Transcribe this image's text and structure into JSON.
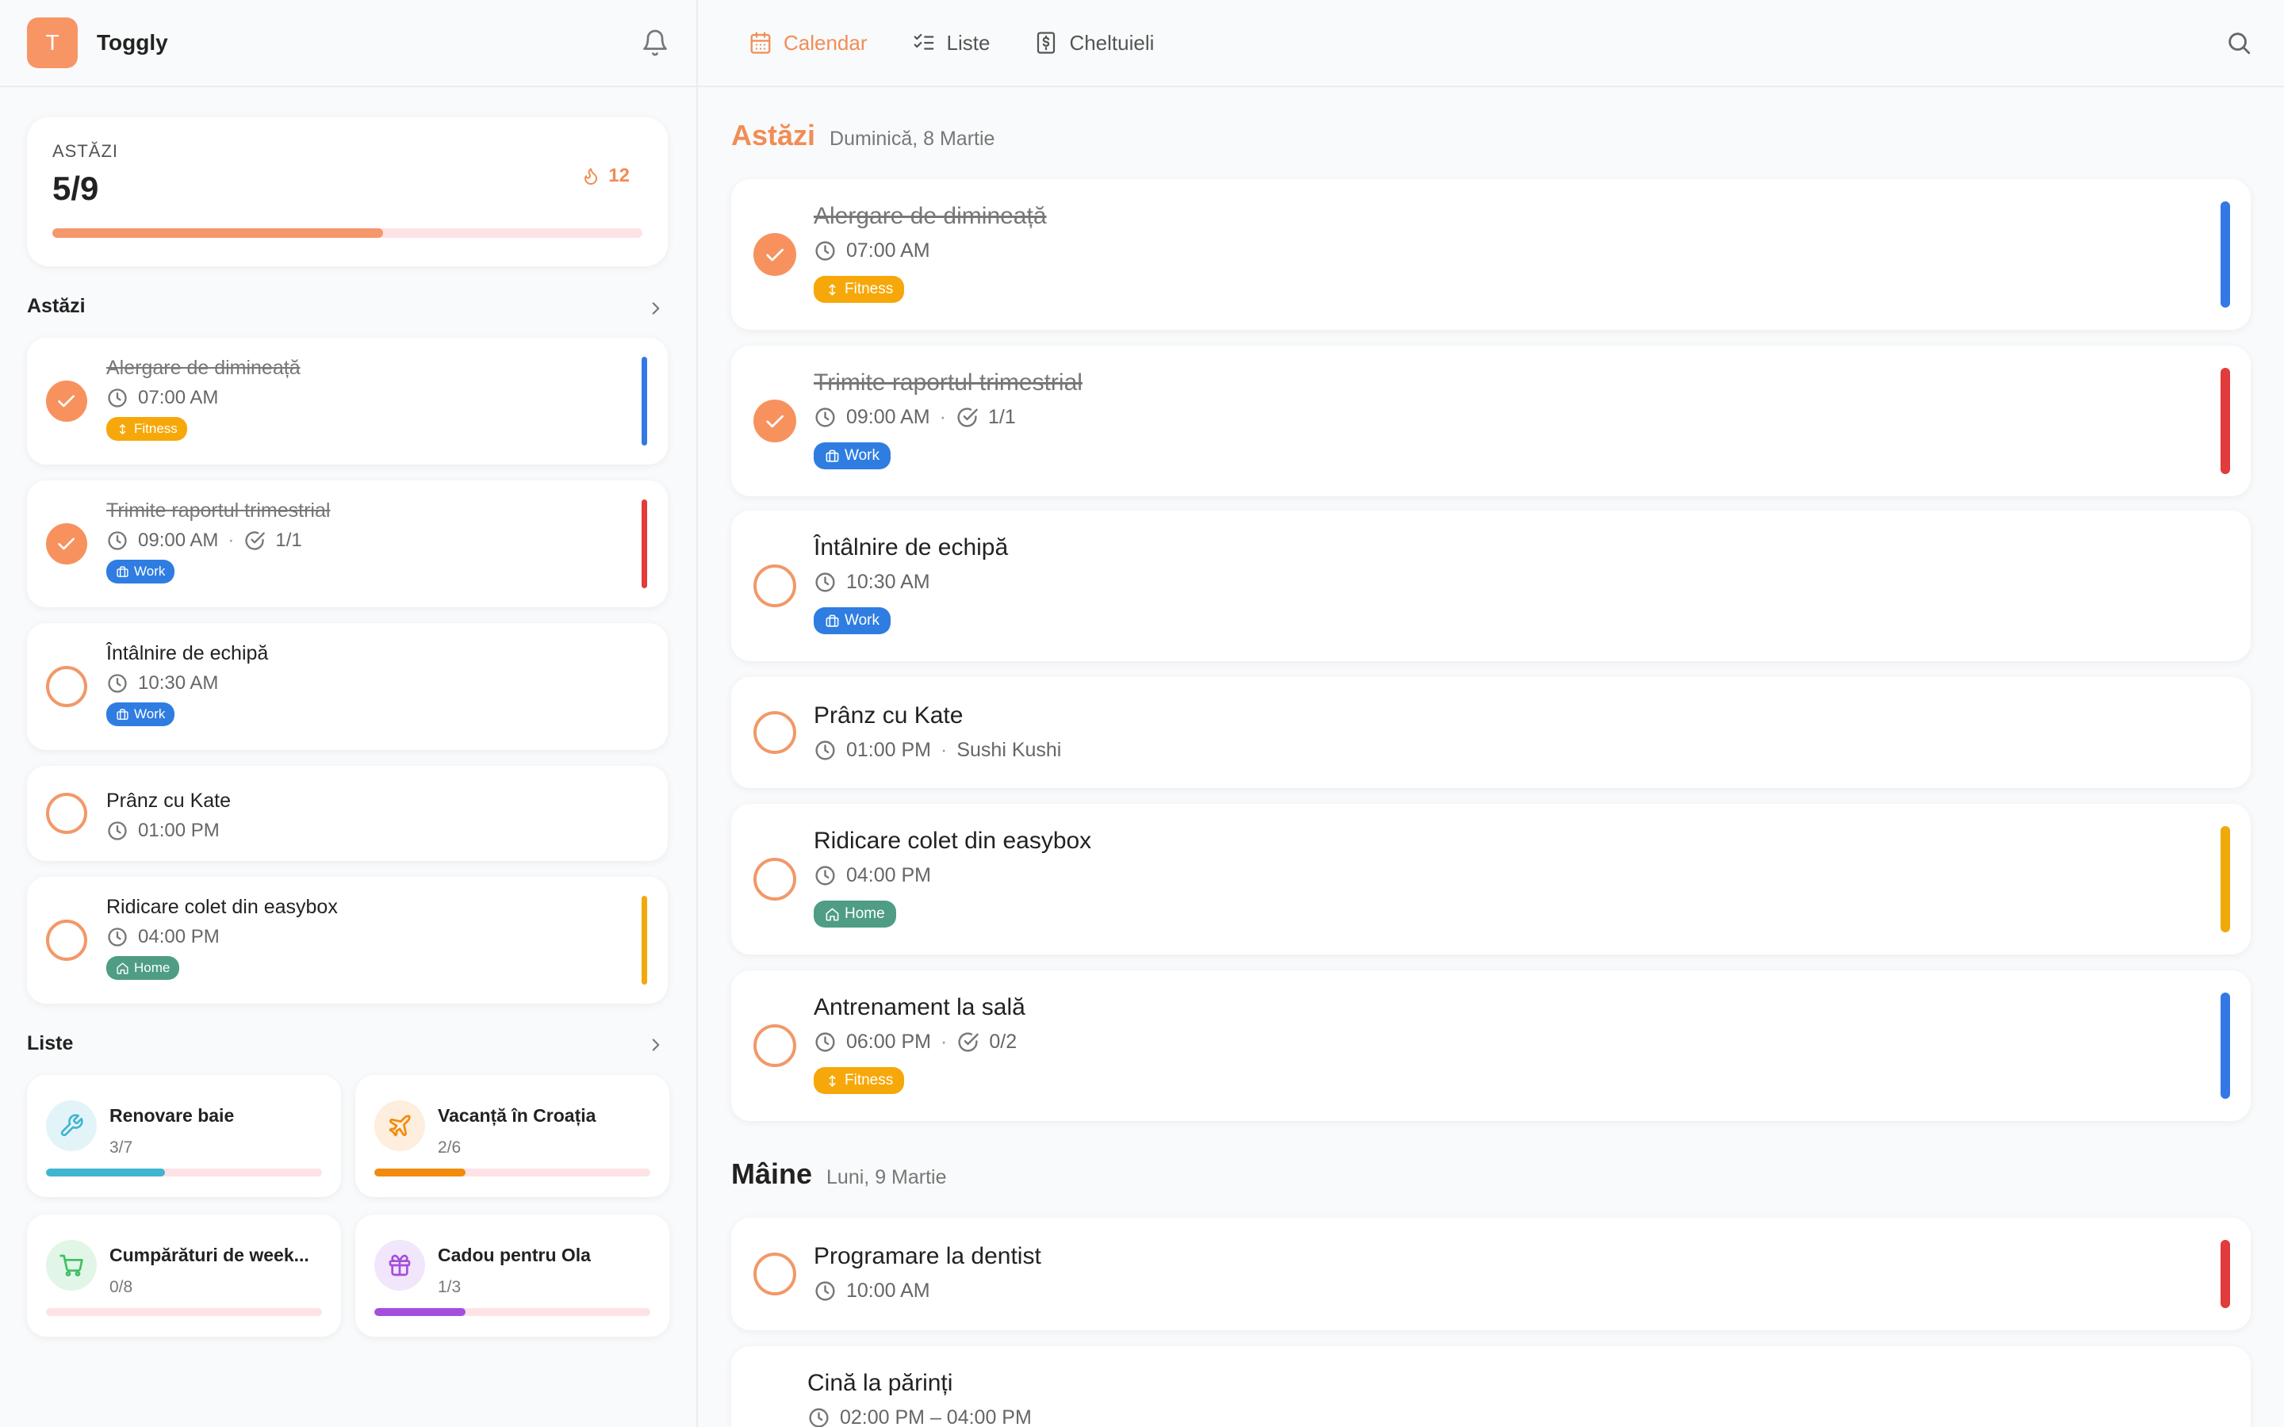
{
  "app": {
    "logo_letter": "T",
    "name": "Toggly"
  },
  "stats": {
    "label": "ASTĂZI",
    "value": "5/9",
    "progress": 0.56,
    "streak": "12"
  },
  "sidebar": {
    "today_title": "Astăzi",
    "lists_title": "Liste",
    "tasks": [
      {
        "title": "Alergare de dimineață",
        "time": "07:00 AM",
        "done": true,
        "tag": "Fitness",
        "tag_type": "fitness",
        "bar": "#3478e5"
      },
      {
        "title": "Trimite raportul trimestrial",
        "time": "09:00 AM",
        "sub": "1/1",
        "done": true,
        "tag": "Work",
        "tag_type": "work",
        "bar": "#e23b3b"
      },
      {
        "title": "Întâlnire de echipă",
        "time": "10:30 AM",
        "done": false,
        "tag": "Work",
        "tag_type": "work"
      },
      {
        "title": "Prânz cu Kate",
        "time": "01:00 PM",
        "done": false
      },
      {
        "title": "Ridicare colet din easybox",
        "time": "04:00 PM",
        "done": false,
        "tag": "Home",
        "tag_type": "home",
        "bar": "#f0a90a"
      }
    ],
    "lists": [
      {
        "name": "Renovare baie",
        "count": "3/7",
        "progress": 0.43,
        "color": "#3fb5cf",
        "bg": "#e3f4f8",
        "icon": "wrench-icon"
      },
      {
        "name": "Vacanță în Croația",
        "count": "2/6",
        "progress": 0.33,
        "color": "#f28a0c",
        "bg": "#fdeedd",
        "icon": "plane-icon"
      },
      {
        "name": "Cumpărături de week...",
        "count": "0/8",
        "progress": 0,
        "color": "#3fbf63",
        "bg": "#e1f6e7",
        "icon": "cart-icon"
      },
      {
        "name": "Cadou pentru Ola",
        "count": "1/3",
        "progress": 0.33,
        "color": "#a34fdc",
        "bg": "#f1e6fb",
        "icon": "gift-icon"
      }
    ]
  },
  "nav": {
    "tabs": [
      {
        "label": "Calendar",
        "icon": "calendar-icon",
        "active": true
      },
      {
        "label": "Liste",
        "icon": "checklist-icon"
      },
      {
        "label": "Cheltuieli",
        "icon": "dollar-icon"
      }
    ]
  },
  "main": {
    "today": {
      "title": "Astăzi",
      "date": "Duminică, 8 Martie"
    },
    "tomorrow": {
      "title": "Mâine",
      "date": "Luni, 9 Martie"
    },
    "today_tasks": [
      {
        "title": "Alergare de dimineață",
        "time": "07:00 AM",
        "done": true,
        "tag": "Fitness",
        "tag_type": "fitness",
        "bar": "#3478e5"
      },
      {
        "title": "Trimite raportul trimestrial",
        "time": "09:00 AM",
        "sub": "1/1",
        "done": true,
        "tag": "Work",
        "tag_type": "work",
        "bar": "#e23b3b"
      },
      {
        "title": "Întâlnire de echipă",
        "time": "10:30 AM",
        "done": false,
        "tag": "Work",
        "tag_type": "work"
      },
      {
        "title": "Prânz cu Kate",
        "time": "01:00 PM",
        "location": "Sushi Kushi",
        "done": false
      },
      {
        "title": "Ridicare colet din easybox",
        "time": "04:00 PM",
        "done": false,
        "tag": "Home",
        "tag_type": "home",
        "bar": "#f0a90a"
      },
      {
        "title": "Antrenament la sală",
        "time": "06:00 PM",
        "sub": "0/2",
        "done": false,
        "tag": "Fitness",
        "tag_type": "fitness",
        "bar": "#3478e5"
      }
    ],
    "tomorrow_tasks": [
      {
        "title": "Programare la dentist",
        "time": "10:00 AM",
        "done": false,
        "bar": "#e23b3b"
      },
      {
        "title": "Cină la părinți",
        "time": "02:00 PM – 04:00 PM",
        "event": true
      }
    ]
  }
}
